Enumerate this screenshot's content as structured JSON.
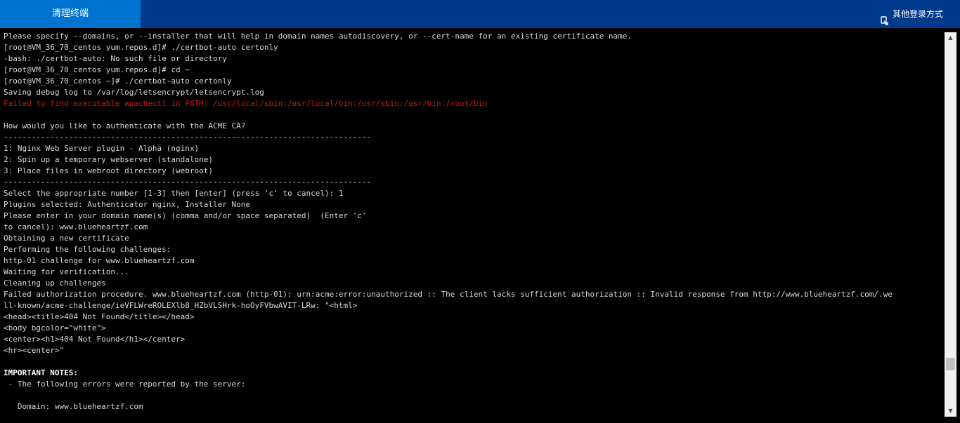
{
  "header": {
    "active_tab_label": "清理终端",
    "other_login_label": "其他登录方式"
  },
  "colors": {
    "header_bg": "#003a8c",
    "active_tab_bg": "#0073d1",
    "terminal_text": "#d8d8d8",
    "terminal_error": "#c21b1b",
    "terminal_bg": "#000000"
  },
  "scrollbar": {
    "up_glyph": "▲",
    "down_glyph": "▼"
  },
  "terminal": {
    "lines": [
      {
        "text": "Please specify --domains, or --installer that will help in domain names autodiscovery, or --cert-name for an existing certificate name.",
        "style": "normal"
      },
      {
        "text": "[root@VM_36_70_centos yum.repos.d]# ./certbot-auto certonly",
        "style": "normal"
      },
      {
        "text": "-bash: ./certbot-auto: No such file or directory",
        "style": "normal"
      },
      {
        "text": "[root@VM_36_70_centos yum.repos.d]# cd ~",
        "style": "normal"
      },
      {
        "text": "[root@VM_36_70_centos ~]# ./certbot-auto certonly",
        "style": "normal"
      },
      {
        "text": "Saving debug log to /var/log/letsencrypt/letsencrypt.log",
        "style": "normal"
      },
      {
        "text": "Failed to find executable apachectl in PATH: /usr/local/sbin:/usr/local/bin:/usr/sbin:/usr/bin:/root/bin",
        "style": "err"
      },
      {
        "text": "",
        "style": "normal"
      },
      {
        "text": "How would you like to authenticate with the ACME CA?",
        "style": "normal"
      },
      {
        "text": "-------------------------------------------------------------------------------",
        "style": "normal"
      },
      {
        "text": "1: Nginx Web Server plugin - Alpha (nginx)",
        "style": "normal"
      },
      {
        "text": "2: Spin up a temporary webserver (standalone)",
        "style": "normal"
      },
      {
        "text": "3: Place files in webroot directory (webroot)",
        "style": "normal"
      },
      {
        "text": "-------------------------------------------------------------------------------",
        "style": "normal"
      },
      {
        "text": "Select the appropriate number [1-3] then [enter] (press 'c' to cancel): 1",
        "style": "normal"
      },
      {
        "text": "Plugins selected: Authenticator nginx, Installer None",
        "style": "normal"
      },
      {
        "text": "Please enter in your domain name(s) (comma and/or space separated)  (Enter 'c'",
        "style": "normal"
      },
      {
        "text": "to cancel): www.blueheartzf.com",
        "style": "normal"
      },
      {
        "text": "Obtaining a new certificate",
        "style": "normal"
      },
      {
        "text": "Performing the following challenges:",
        "style": "normal"
      },
      {
        "text": "http-01 challenge for www.blueheartzf.com",
        "style": "normal"
      },
      {
        "text": "Waiting for verification...",
        "style": "normal"
      },
      {
        "text": "Cleaning up challenges",
        "style": "normal"
      },
      {
        "text": "Failed authorization procedure. www.blueheartzf.com (http-01): urn:acme:error:unauthorized :: The client lacks sufficient authorization :: Invalid response from http://www.blueheartzf.com/.we",
        "style": "normal"
      },
      {
        "text": "ll-known/acme-challenge/ieVFLWreROLEXlb8_HZbVLSHrk-hoOyFVbwAVIT-LRw: \"<html>",
        "style": "normal"
      },
      {
        "text": "<head><title>404 Not Found</title></head>",
        "style": "normal"
      },
      {
        "text": "<body bgcolor=\"white\">",
        "style": "normal"
      },
      {
        "text": "<center><h1>404 Not Found</h1></center>",
        "style": "normal"
      },
      {
        "text": "<hr><center>\"",
        "style": "normal"
      },
      {
        "text": "",
        "style": "normal"
      },
      {
        "text": "IMPORTANT NOTES:",
        "style": "bold"
      },
      {
        "text": " - The following errors were reported by the server:",
        "style": "normal"
      },
      {
        "text": "",
        "style": "normal"
      },
      {
        "text": "   Domain: www.blueheartzf.com",
        "style": "normal"
      }
    ]
  }
}
